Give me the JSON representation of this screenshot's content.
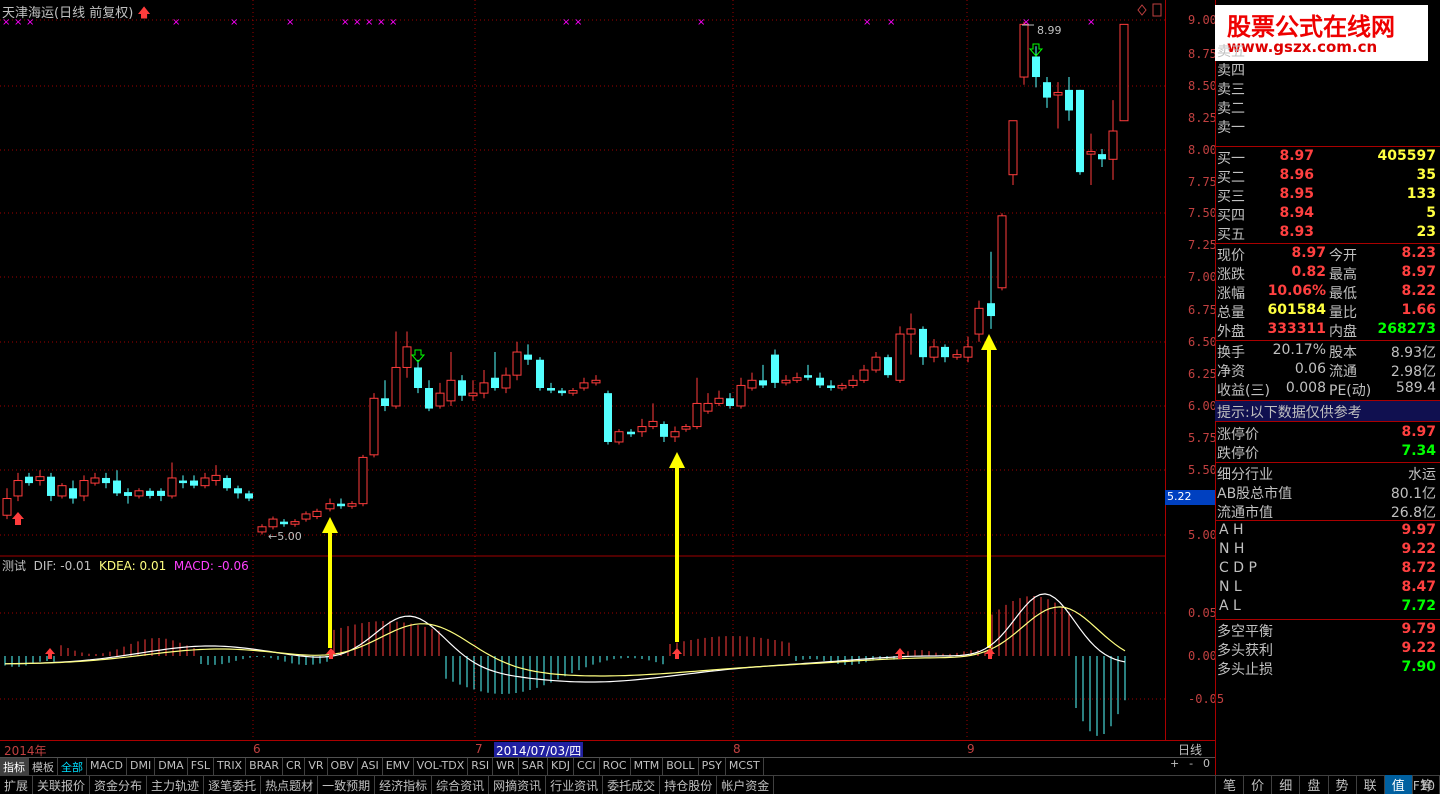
{
  "header": {
    "title": "天津海运(日线 前复权)"
  },
  "logo": {
    "line1": "股票公式在线网",
    "line2": "www.gszx.com.cn"
  },
  "axis": {
    "price_ticks": [
      "9.00",
      "8.75",
      "8.50",
      "8.25",
      "8.00",
      "7.75",
      "7.50",
      "7.25",
      "7.00",
      "6.75",
      "6.50",
      "6.25",
      "6.00",
      "5.75",
      "5.50",
      "5.00"
    ],
    "current_price_tag": "5.22",
    "macd_ticks": [
      "0.05",
      "0.00",
      "-0.05"
    ]
  },
  "annotations": {
    "high_label": "8.99",
    "low_label": "5.00"
  },
  "macd_legend": {
    "name": "测试",
    "dif": "DIF: -0.01",
    "kdea": "KDEA: 0.01",
    "macd": "MACD: -0.06"
  },
  "dates": {
    "start": "2014年",
    "m6": "6",
    "m7": "7",
    "selected": "2014/07/03/四",
    "m8": "8",
    "m9": "9",
    "period": "日线"
  },
  "tabs": [
    "指标",
    "模板",
    "全部",
    "MACD",
    "DMI",
    "DMA",
    "FSL",
    "TRIX",
    "BRAR",
    "CR",
    "VR",
    "OBV",
    "ASI",
    "EMV",
    "VOL-TDX",
    "RSI",
    "WR",
    "SAR",
    "KDJ",
    "CCI",
    "ROC",
    "MTM",
    "BOLL",
    "PSY",
    "MCST"
  ],
  "controls": [
    "+",
    "-",
    "0"
  ],
  "menu": [
    "扩展",
    "关联报价",
    "资金分布",
    "主力轨迹",
    "逐笔委托",
    "热点题材",
    "一致预期",
    "经济指标",
    "综合资讯",
    "网摘资讯",
    "行业资讯",
    "委托成交",
    "持仓股份",
    "帐户资金",
    "图文F10"
  ],
  "sidetabs": [
    "笔",
    "价",
    "细",
    "盘",
    "势",
    "联",
    "值",
    "筹"
  ],
  "order_book": {
    "sell": [
      {
        "label": "卖五"
      },
      {
        "label": "卖四"
      },
      {
        "label": "卖三"
      },
      {
        "label": "卖二"
      },
      {
        "label": "卖一"
      }
    ],
    "buy": [
      {
        "label": "买一",
        "price": "8.97",
        "vol": "405597"
      },
      {
        "label": "买二",
        "price": "8.96",
        "vol": "35"
      },
      {
        "label": "买三",
        "price": "8.95",
        "vol": "133"
      },
      {
        "label": "买四",
        "price": "8.94",
        "vol": "5"
      },
      {
        "label": "买五",
        "price": "8.93",
        "vol": "23"
      }
    ]
  },
  "quote": [
    {
      "l1": "现价",
      "v1": "8.97",
      "l2": "今开",
      "v2": "8.23"
    },
    {
      "l1": "涨跌",
      "v1": "0.82",
      "l2": "最高",
      "v2": "8.97"
    },
    {
      "l1": "涨幅",
      "v1": "10.06%",
      "l2": "最低",
      "v2": "8.22"
    },
    {
      "l1": "总量",
      "v1": "601584",
      "l2": "量比",
      "v2": "1.66"
    },
    {
      "l1": "外盘",
      "v1": "333311",
      "l2": "内盘",
      "v2": "268273"
    }
  ],
  "stats": [
    {
      "l1": "换手",
      "v1": "20.17%",
      "l2": "股本",
      "v2": "8.93亿"
    },
    {
      "l1": "净资",
      "v1": "0.06",
      "l2": "流通",
      "v2": "2.98亿"
    },
    {
      "l1": "收益(三)",
      "v1": "0.008",
      "l2": "PE(动)",
      "v2": "589.4"
    }
  ],
  "notice": "提示:以下数据仅供参考",
  "limits": [
    {
      "label": "涨停价",
      "value": "8.97"
    },
    {
      "label": "跌停价",
      "value": "7.34"
    }
  ],
  "industry": [
    {
      "label": "细分行业",
      "value": "水运"
    },
    {
      "label": "AB股总市值",
      "value": "80.1亿"
    },
    {
      "label": "流通市值",
      "value": "26.8亿"
    }
  ],
  "levels": [
    {
      "label": "A H",
      "value": "9.97"
    },
    {
      "label": "N H",
      "value": "9.22"
    },
    {
      "label": "C D P",
      "value": "8.72"
    },
    {
      "label": "N L",
      "value": "8.47"
    },
    {
      "label": "A L",
      "value": "7.72"
    }
  ],
  "balance": [
    {
      "label": "多空平衡",
      "value": "9.79"
    },
    {
      "label": "多头获利",
      "value": "9.22"
    },
    {
      "label": "多头止损",
      "value": "7.90"
    }
  ],
  "colors": {
    "up": "#ff3c3c",
    "down": "#54ffff",
    "grid": "#a00000",
    "yellow": "#ffff00",
    "purple": "#ff00ff",
    "green": "#00ff00"
  }
}
